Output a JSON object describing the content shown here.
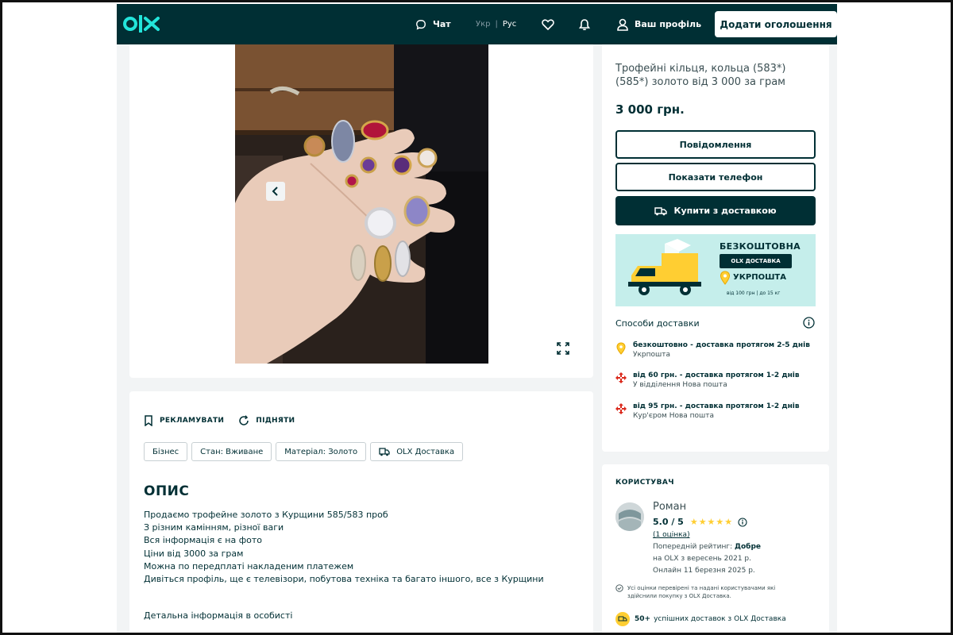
{
  "header": {
    "chat_label": "Чат",
    "lang_active": "Укр",
    "lang_sep": "|",
    "lang_other": "Рус",
    "profile_label": "Ваш профіль",
    "add_button": "Додати оголошення"
  },
  "ad": {
    "title": "Трофейні кільця, кольца (583*) (585*) золото від 3 000 за грам",
    "price": "3 000 грн.",
    "message_button": "Повідомлення",
    "phone_button": "Показати телефон",
    "buy_button": "Купити з доставкою"
  },
  "promo": {
    "title": "БЕЗКОШТОВНА",
    "badge": "OLX ДОСТАВКА",
    "carrier": "УКРПОШТА",
    "note": "від 100 грн | до 15 кг"
  },
  "delivery": {
    "heading": "Способи доставки",
    "items": [
      {
        "main": "безкоштовно - доставка протягом 2-5 днів",
        "sub": "Укрпошта",
        "icon": "ukrposhta-pin-icon"
      },
      {
        "main": "від 60 грн. - доставка протягом 1-2 днів",
        "sub": "У відділення Нова пошта",
        "icon": "nova-poshta-icon"
      },
      {
        "main": "від 95 грн. - доставка протягом 1-2 днів",
        "sub": "Кур'єром Нова пошта",
        "icon": "nova-poshta-icon"
      }
    ]
  },
  "details": {
    "promote": "РЕКЛАМУВАТИ",
    "raise": "ПІДНЯТИ",
    "tags": [
      "Бізнес",
      "Стан: Вживане",
      "Матеріал: Золото",
      "OLX Доставка"
    ],
    "description_title": "ОПИС",
    "description_lines": [
      "Продаємо трофейне золото з Курщини 585/583 проб",
      "З різним камінням, різної ваги",
      "Вся інформація є на фото",
      "Ціни від 3000 за грам",
      "Можна по передплаті накладеним платежем",
      "Дивіться профіль, ще є телевізори, побутова техніка та багато іншого, все з Курщини"
    ],
    "more_info": "Детальна інформація в особисті"
  },
  "user": {
    "heading": "КОРИСТУВАЧ",
    "name": "Роман",
    "rating": "5.0 / 5",
    "stars": "★★★★★",
    "reviews": "(1 оцінка)",
    "prev_rating_label": "Попередній рейтинг:",
    "prev_rating_value": "Добре",
    "on_olx": "на OLX з вересень 2021 р.",
    "online": "Онлайн 11 березня 2025 р.",
    "verify_note": "Усі оцінки перевірені та надані користувачами які здійснили покупку з OLX Доставка.",
    "deliveries_count": "50+",
    "deliveries_text": "успішних доставок з OLX Доставка"
  }
}
